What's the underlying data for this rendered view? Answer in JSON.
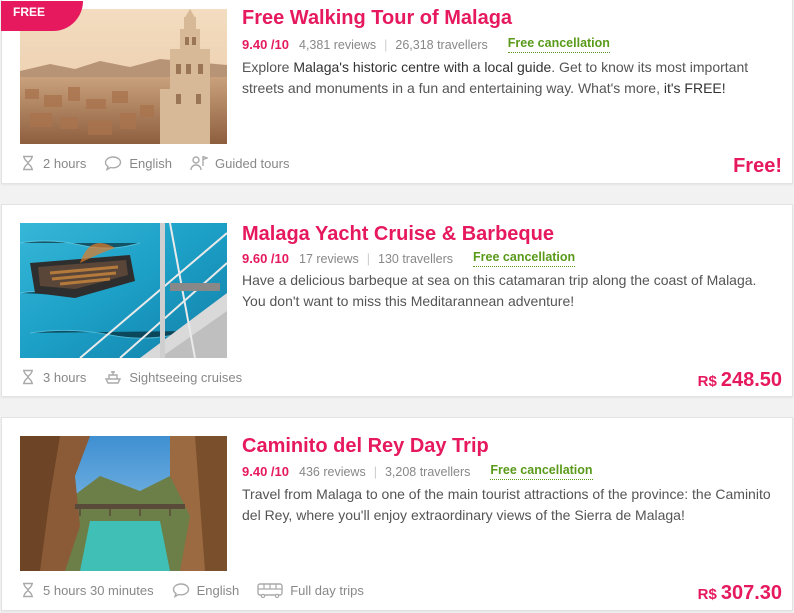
{
  "tours": [
    {
      "ribbon": "FREE",
      "title": "Free Walking Tour of Malaga",
      "score": "9.40 /10",
      "reviews": "4,381 reviews",
      "travellers": "26,318 travellers",
      "cancellation": "Free cancellation",
      "desc": {
        "p1": "Explore ",
        "h1": "Malaga's historic centre with a local guide",
        "p2": ". Get to know its most important streets and monuments in a fun and entertaining way. What's more, ",
        "h2": "it's FREE!",
        "p3": ""
      },
      "features": [
        {
          "icon": "hourglass-icon",
          "label": "2 hours"
        },
        {
          "icon": "speech-bubble-icon",
          "label": "English"
        },
        {
          "icon": "guide-icon",
          "label": "Guided tours"
        }
      ],
      "price": {
        "currency": "",
        "amount": "Free!"
      }
    },
    {
      "title": "Malaga Yacht Cruise & Barbeque",
      "score": "9.60 /10",
      "reviews": "17 reviews",
      "travellers": "130 travellers",
      "cancellation": "Free cancellation",
      "desc": {
        "p1": "Have a delicious barbeque at sea on this catamaran trip along the coast of Malaga. You don't want to miss this Meditarannean adventure!"
      },
      "features": [
        {
          "icon": "hourglass-icon",
          "label": "3 hours"
        },
        {
          "icon": "ship-icon",
          "label": "Sightseeing cruises"
        }
      ],
      "price": {
        "currency": "R$",
        "amount": "248.50"
      }
    },
    {
      "title": "Caminito del Rey Day Trip",
      "score": "9.40 /10",
      "reviews": "436 reviews",
      "travellers": "3,208 travellers",
      "cancellation": "Free cancellation",
      "desc": {
        "p1": "Travel from Malaga to one of the main tourist attractions of the province: the Caminito del Rey, where you'll enjoy extraordinary views of the Sierra de Malaga!"
      },
      "features": [
        {
          "icon": "hourglass-icon",
          "label": "5 hours 30 minutes"
        },
        {
          "icon": "speech-bubble-icon",
          "label": "English"
        },
        {
          "icon": "bus-icon",
          "label": "Full day trips"
        }
      ],
      "price": {
        "currency": "R$",
        "amount": "307.30"
      }
    }
  ],
  "colors": {
    "accent": "#e6195f",
    "cancel": "#5a9a1a",
    "muted": "#888888"
  }
}
